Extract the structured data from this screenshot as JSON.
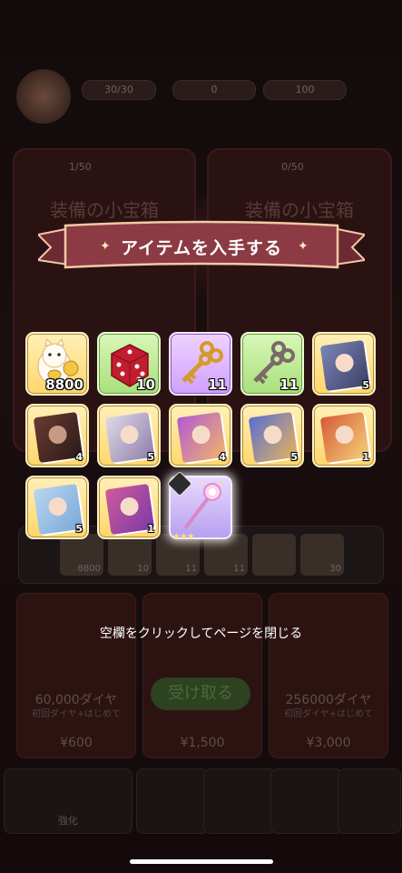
{
  "background": {
    "hud": {
      "stamina": "30/30",
      "gems": "0",
      "coins": "100"
    },
    "cards": [
      {
        "counter": "1/50",
        "title": "装備の小宝箱"
      },
      {
        "counter": "0/50",
        "title": "装備の小宝箱"
      }
    ],
    "strip_counts": [
      "8800",
      "10",
      "11",
      "11",
      "",
      "30"
    ],
    "packs": [
      {
        "amount": "60,000ダイヤ",
        "sub": "初回ダイヤ+はじめて",
        "price": "¥600"
      },
      {
        "amount": "",
        "sub": "",
        "price": "¥1,500"
      },
      {
        "amount": "256000ダイヤ",
        "sub": "初回ダイヤ+はじめて",
        "price": "¥3,000"
      }
    ],
    "take_button": "受け取る",
    "nav": [
      "強化",
      "",
      "",
      "",
      ""
    ]
  },
  "modal": {
    "title": "アイテムを入手する",
    "close_hint": "空欄をクリックしてページを閉じる",
    "items": [
      {
        "icon": "lucky-cat-icon",
        "frame": "gold",
        "count": "8800"
      },
      {
        "icon": "dice-icon",
        "frame": "green",
        "count": "10"
      },
      {
        "icon": "gold-key-icon",
        "frame": "purple",
        "count": "11"
      },
      {
        "icon": "silver-key-icon",
        "frame": "green",
        "count": "11"
      },
      {
        "icon": "hero-card-icon",
        "frame": "gold",
        "count": "5"
      },
      {
        "icon": "hero-card-icon",
        "frame": "gold",
        "count": "4"
      },
      {
        "icon": "hero-card-icon",
        "frame": "gold",
        "count": "5"
      },
      {
        "icon": "hero-card-icon",
        "frame": "gold",
        "count": "4"
      },
      {
        "icon": "hero-card-icon",
        "frame": "gold",
        "count": "5"
      },
      {
        "icon": "hero-card-icon",
        "frame": "gold",
        "count": "1"
      },
      {
        "icon": "hero-card-icon",
        "frame": "gold",
        "count": "5"
      },
      {
        "icon": "hero-card-icon",
        "frame": "gold",
        "count": "1"
      },
      {
        "icon": "magic-wand-icon",
        "frame": "lilac",
        "count": ""
      }
    ]
  },
  "colors": {
    "ribbon": "#8c3a44",
    "ribbon_edge": "#f2c9a4"
  }
}
